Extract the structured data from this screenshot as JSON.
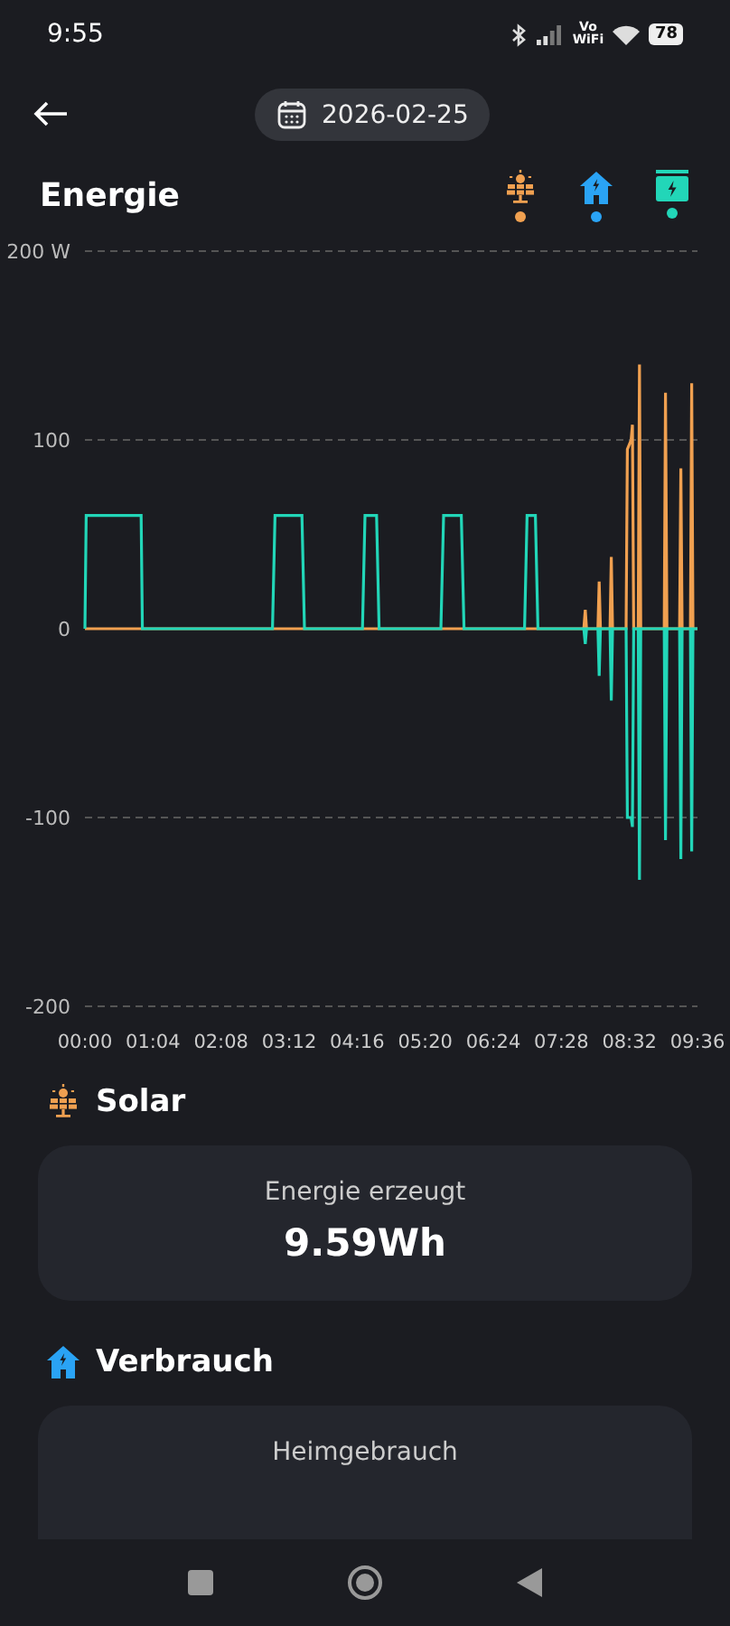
{
  "status_bar": {
    "time": "9:55",
    "network_label": "Vo WiFi",
    "battery": "78"
  },
  "header": {
    "date": "2026-02-25"
  },
  "energy": {
    "title": "Energie",
    "legend": [
      {
        "kind": "solar",
        "color": "#f0a050"
      },
      {
        "kind": "home",
        "color": "#2aa3f5"
      },
      {
        "kind": "battery",
        "color": "#22d6b8"
      }
    ],
    "chart_data": {
      "type": "line",
      "ylim": [
        -200,
        200
      ],
      "xlim": [
        0,
        9.6
      ],
      "yticks": [
        {
          "value": 200,
          "label": "200 W"
        },
        100,
        0,
        -100,
        -200
      ],
      "xticks": [
        {
          "value": 0,
          "label": "00:00"
        },
        {
          "value": 1.0667,
          "label": "01:04"
        },
        {
          "value": 2.1333,
          "label": "02:08"
        },
        {
          "value": 3.2,
          "label": "03:12"
        },
        {
          "value": 4.2667,
          "label": "04:16"
        },
        {
          "value": 5.3333,
          "label": "05:20"
        },
        {
          "value": 6.4,
          "label": "06:24"
        },
        {
          "value": 7.4667,
          "label": "07:28"
        },
        {
          "value": 8.5333,
          "label": "08:32"
        },
        {
          "value": 9.6,
          "label": "09:36"
        }
      ],
      "x": [
        0,
        0.02,
        0.88,
        0.9,
        2.94,
        2.98,
        3.4,
        3.44,
        4.35,
        4.39,
        4.57,
        4.61,
        5.58,
        5.62,
        5.9,
        5.94,
        6.89,
        6.93,
        7.06,
        7.1,
        7.82,
        7.84,
        7.86,
        8.04,
        8.06,
        8.08,
        8.23,
        8.25,
        8.27,
        8.48,
        8.5,
        8.56,
        8.58,
        8.6,
        8.67,
        8.69,
        8.71,
        9.08,
        9.1,
        9.12,
        9.32,
        9.34,
        9.36,
        9.49,
        9.51,
        9.53,
        9.6
      ],
      "series": [
        {
          "color": "#f0a050",
          "values": [
            0,
            0,
            0,
            0,
            0,
            0,
            0,
            0,
            0,
            0,
            0,
            0,
            0,
            0,
            0,
            0,
            0,
            0,
            0,
            0,
            0,
            10,
            0,
            0,
            25,
            0,
            0,
            38,
            0,
            0,
            95,
            100,
            108,
            0,
            0,
            140,
            0,
            0,
            125,
            0,
            0,
            85,
            0,
            0,
            130,
            0,
            0
          ]
        },
        {
          "color": "#22d6b8",
          "values": [
            0,
            60,
            60,
            0,
            0,
            60,
            60,
            0,
            0,
            60,
            60,
            0,
            0,
            60,
            60,
            0,
            0,
            60,
            60,
            0,
            0,
            -8,
            0,
            0,
            -25,
            0,
            0,
            -38,
            0,
            0,
            -100,
            -100,
            -105,
            0,
            0,
            -133,
            0,
            0,
            -112,
            0,
            0,
            -122,
            0,
            0,
            -118,
            0,
            0
          ]
        }
      ]
    }
  },
  "sections": [
    {
      "kind": "solar",
      "title": "Solar",
      "label": "Energie erzeugt",
      "value": "9.59Wh"
    },
    {
      "kind": "home",
      "title": "Verbrauch",
      "label": "Heimgebrauch"
    }
  ]
}
